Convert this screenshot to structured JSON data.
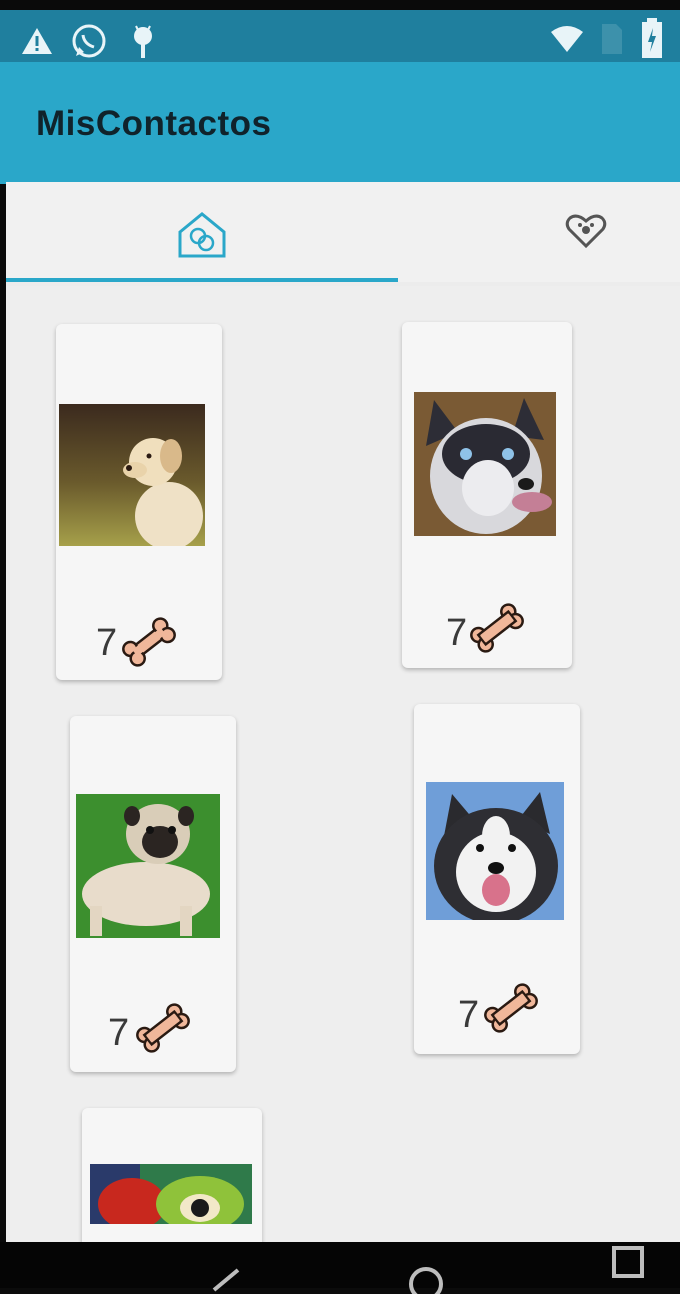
{
  "app": {
    "title": "MisContactos"
  },
  "status_bar": {
    "icons": [
      "warning-icon",
      "whatsapp-icon",
      "android-icon",
      "wifi-icon",
      "sim-icon",
      "battery-icon"
    ]
  },
  "tabs": [
    {
      "icon": "dog-house-icon",
      "selected": true
    },
    {
      "icon": "heart-paw-icon",
      "selected": false
    }
  ],
  "pets": [
    {
      "photo": "labrador-photo",
      "likes": "7"
    },
    {
      "photo": "husky-photo",
      "likes": "7"
    },
    {
      "photo": "pug-photo",
      "likes": "7"
    },
    {
      "photo": "malamute-photo",
      "likes": "7"
    },
    {
      "photo": "parrot-photo",
      "likes": ""
    }
  ],
  "colors": {
    "toolbar": "#2aa7c9",
    "status_bar": "#1f7f9e",
    "accent": "#2aa7c9",
    "bone": "#f0b79a"
  },
  "nav_bar": {
    "icons": [
      "back-icon",
      "home-icon",
      "recents-icon"
    ]
  }
}
